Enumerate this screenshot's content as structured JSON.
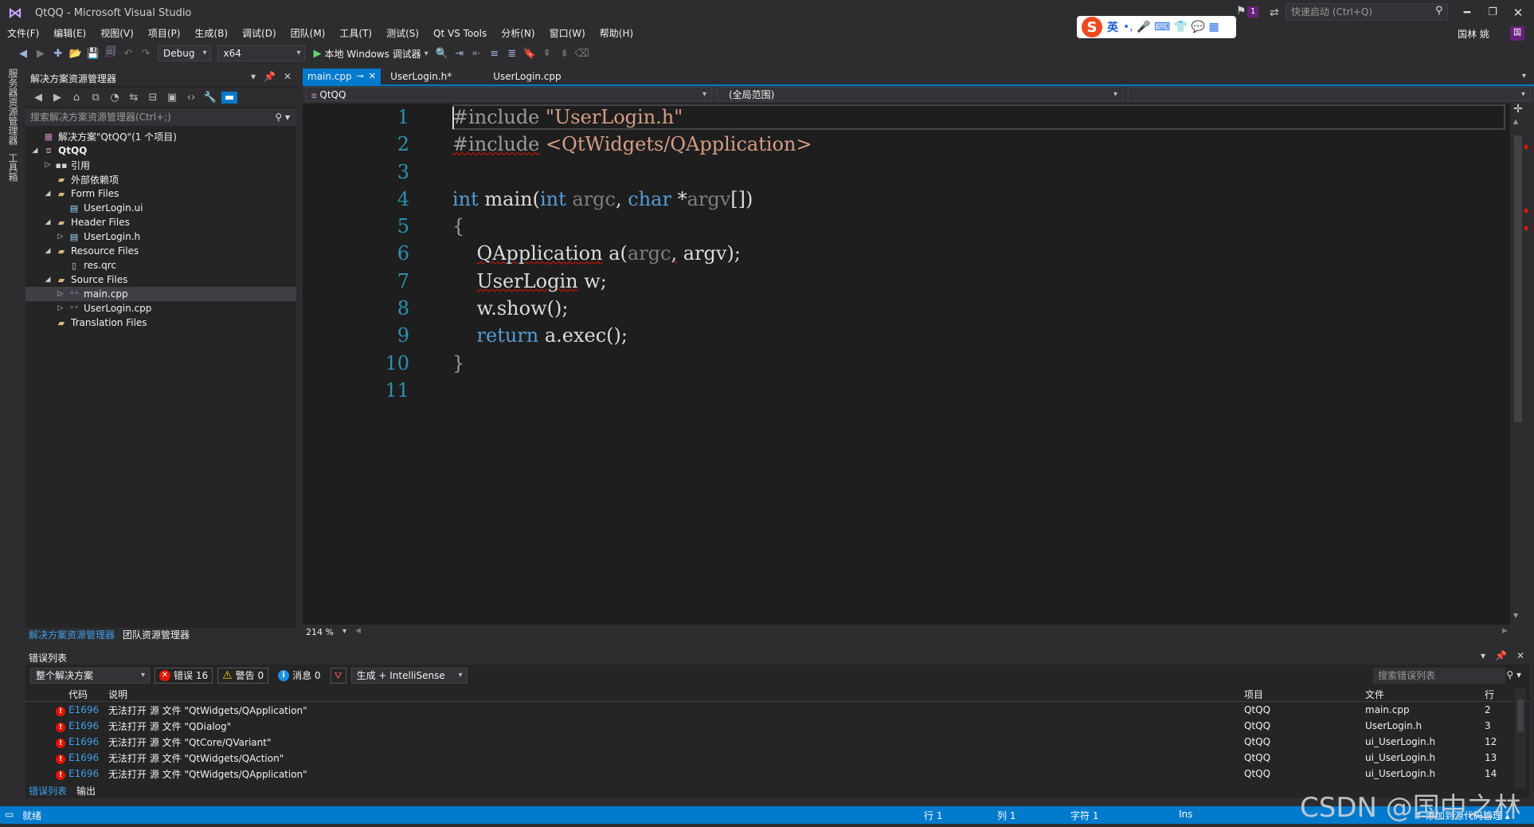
{
  "window": {
    "title": "QtQQ - Microsoft Visual Studio"
  },
  "titlebar": {
    "ime": {
      "lang": "英",
      "marks": "•, 🎤 ⌨ 👕 💬 ▦"
    },
    "notification_count": "1",
    "quick_launch_placeholder": "快速启动 (Ctrl+Q)",
    "user_name": "国林 姚",
    "user_initial": "国"
  },
  "menu": [
    "文件(F)",
    "编辑(E)",
    "视图(V)",
    "项目(P)",
    "生成(B)",
    "调试(D)",
    "团队(M)",
    "工具(T)",
    "测试(S)",
    "Qt VS Tools",
    "分析(N)",
    "窗口(W)",
    "帮助(H)"
  ],
  "toolbar": {
    "config": "Debug",
    "platform": "x64",
    "run_label": "本地 Windows 调试器"
  },
  "left_strip": {
    "server_explorer": "服务器资源管理器",
    "toolbox": "工具箱"
  },
  "solution_explorer": {
    "title": "解决方案资源管理器",
    "search_placeholder": "搜索解决方案资源管理器(Ctrl+;)",
    "tree": [
      {
        "label": "解决方案\"QtQQ\"(1 个项目)"
      },
      {
        "label": "QtQQ"
      },
      {
        "label": "引用"
      },
      {
        "label": "外部依赖项"
      },
      {
        "label": "Form Files"
      },
      {
        "label": "UserLogin.ui"
      },
      {
        "label": "Header Files"
      },
      {
        "label": "UserLogin.h"
      },
      {
        "label": "Resource Files"
      },
      {
        "label": "res.qrc"
      },
      {
        "label": "Source Files"
      },
      {
        "label": "main.cpp"
      },
      {
        "label": "UserLogin.cpp"
      },
      {
        "label": "Translation Files"
      }
    ],
    "bottom_tabs": [
      "解决方案资源管理器",
      "团队资源管理器"
    ]
  },
  "editor": {
    "tabs": [
      "main.cpp",
      "UserLogin.h*",
      "UserLogin.cpp"
    ],
    "nav_project": "QtQQ",
    "nav_scope": "(全局范围)",
    "zoom": "214 %",
    "line_numbers": [
      "1",
      "2",
      "3",
      "4",
      "5",
      "6",
      "7",
      "8",
      "9",
      "10",
      "11"
    ],
    "code": {
      "l1_dir": "#include",
      "l1_str": "\"UserLogin.h\"",
      "l2_dir": "#include",
      "l2_str": "<QtWidgets/QApplication>",
      "l4_int1": "int",
      "l4_main": " main(",
      "l4_int2": "int",
      "l4_argc": " argc",
      "l4_comma": ", ",
      "l4_char": "char",
      "l4_star": " *",
      "l4_argv": "argv",
      "l4_end": "[])",
      "l5": "{",
      "l6_type": "QApplication",
      "l6_a": " a(",
      "l6_argc": "argc",
      "l6_comma": ",",
      "l6_rest": " argv);",
      "l7_type": "UserLogin",
      "l7_rest": " w;",
      "l8": "w.show();",
      "l9_ret": "return",
      "l9_rest": " a.exec();",
      "l10": "}"
    }
  },
  "error_list": {
    "title": "错误列表",
    "scope": "整个解决方案",
    "errors_label": "错误 16",
    "warnings_label": "警告 0",
    "messages_label": "消息 0",
    "source": "生成 + IntelliSense",
    "search_placeholder": "搜索错误列表",
    "columns": {
      "code": "代码",
      "desc": "说明",
      "project": "项目",
      "file": "文件",
      "line": "行"
    },
    "rows": [
      {
        "code": "E1696",
        "desc": "无法打开 源 文件 \"QtWidgets/QApplication\"",
        "project": "QtQQ",
        "file": "main.cpp",
        "line": "2"
      },
      {
        "code": "E1696",
        "desc": "无法打开 源 文件 \"QDialog\"",
        "project": "QtQQ",
        "file": "UserLogin.h",
        "line": "3"
      },
      {
        "code": "E1696",
        "desc": "无法打开 源 文件 \"QtCore/QVariant\"",
        "project": "QtQQ",
        "file": "ui_UserLogin.h",
        "line": "12"
      },
      {
        "code": "E1696",
        "desc": "无法打开 源 文件 \"QtWidgets/QAction\"",
        "project": "QtQQ",
        "file": "ui_UserLogin.h",
        "line": "13"
      },
      {
        "code": "E1696",
        "desc": "无法打开 源 文件 \"QtWidgets/QApplication\"",
        "project": "QtQQ",
        "file": "ui_UserLogin.h",
        "line": "14"
      }
    ],
    "bottom_tabs": [
      "错误列表",
      "输出"
    ]
  },
  "statusbar": {
    "ready": "就绪",
    "line": "行 1",
    "col": "列 1",
    "char": "字符 1",
    "ins": "Ins",
    "add_source": "↑ 添加到源代码管理 ▴"
  },
  "watermark": "CSDN @国中之林",
  "colors": {
    "accent": "#007acc",
    "error": "#e51400",
    "keyword": "#569cd6",
    "string": "#d69d85",
    "line_number": "#2b91af"
  }
}
